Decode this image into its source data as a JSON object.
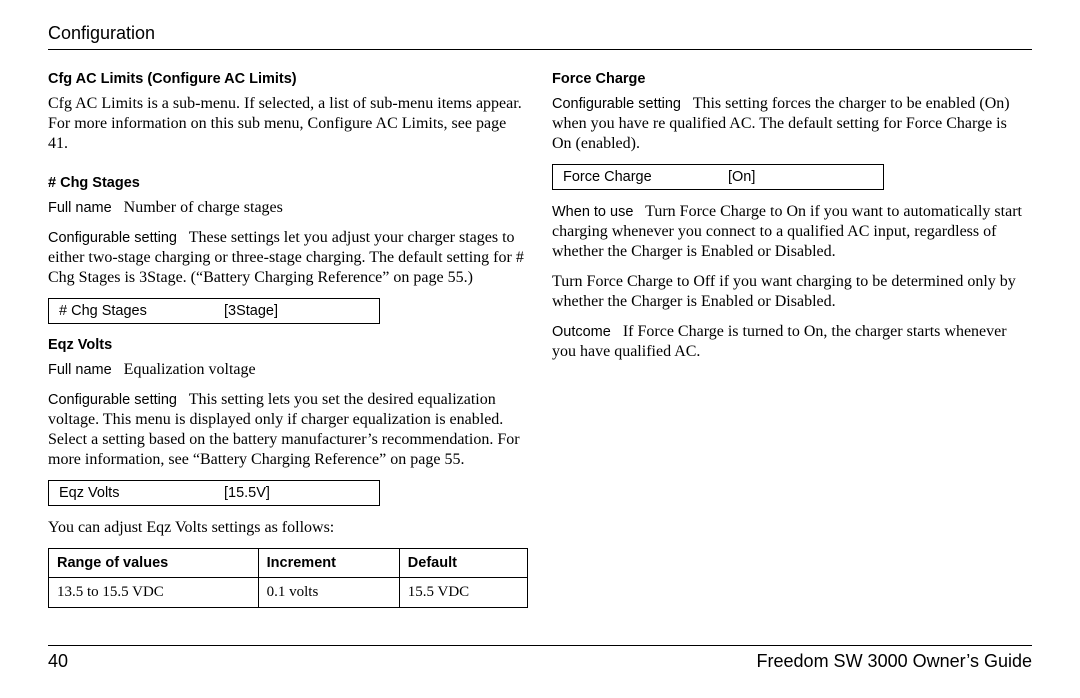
{
  "header": {
    "title": "Configuration"
  },
  "left": {
    "cfg_head": "Cfg AC Limits (Configure AC Limits)",
    "cfg_body": "Cfg AC Limits is a sub-menu. If selected, a list of sub-menu items appear. For more information on this sub menu, Configure AC Limits, see page 41.",
    "chg_head": "# Chg Stages",
    "chg_fullname_label": "Full name",
    "chg_fullname_value": "Number of charge stages",
    "chg_cfg_label": "Configurable setting",
    "chg_cfg_body": "These settings let you adjust your charger stages to either two-stage charging or three-stage charging. The default setting for # Chg Stages is 3Stage. (“Battery Charging Reference” on page 55.)",
    "chg_lcd_label": "# Chg Stages",
    "chg_lcd_value": "[3Stage]",
    "eqz_head": "Eqz Volts",
    "eqz_fullname_label": "Full name",
    "eqz_fullname_value": "Equalization voltage",
    "eqz_cfg_label": "Configurable setting",
    "eqz_cfg_body": "This setting lets you set the desired equalization voltage. This menu is displayed only if charger equalization is enabled. Select a setting based on the battery manufacturer’s recommendation. For more information, see “Battery Charging Reference” on page 55.",
    "eqz_lcd_label": "Eqz Volts",
    "eqz_lcd_value": "[15.5V]",
    "eqz_note": "You can adjust Eqz Volts settings as follows:",
    "range_table": {
      "h1": "Range of values",
      "h2": "Increment",
      "h3": "Default",
      "c1": "13.5 to 15.5 VDC",
      "c2": "0.1 volts",
      "c3": "15.5 VDC"
    }
  },
  "right": {
    "fc_head": "Force Charge",
    "fc_cfg_label": "Configurable setting",
    "fc_cfg_body": "This setting forces the charger to be enabled (On) when you have re qualified AC. The default setting for Force Charge is On (enabled).",
    "fc_lcd_label": "Force Charge",
    "fc_lcd_value": "[On]",
    "fc_when_label": "When to use",
    "fc_when_body1": "Turn Force Charge to On if you want to automatically start charging whenever you connect to a qualified AC input, regardless of whether the Charger is Enabled or Disabled.",
    "fc_when_body2": "Turn Force Charge to Off if you want charging to be determined only by whether the Charger is Enabled or Disabled.",
    "fc_out_label": "Outcome",
    "fc_out_body": "If Force Charge is turned to On, the charger starts whenever you have qualified AC."
  },
  "footer": {
    "page": "40",
    "book": "Freedom SW 3000 Owner’s Guide"
  }
}
